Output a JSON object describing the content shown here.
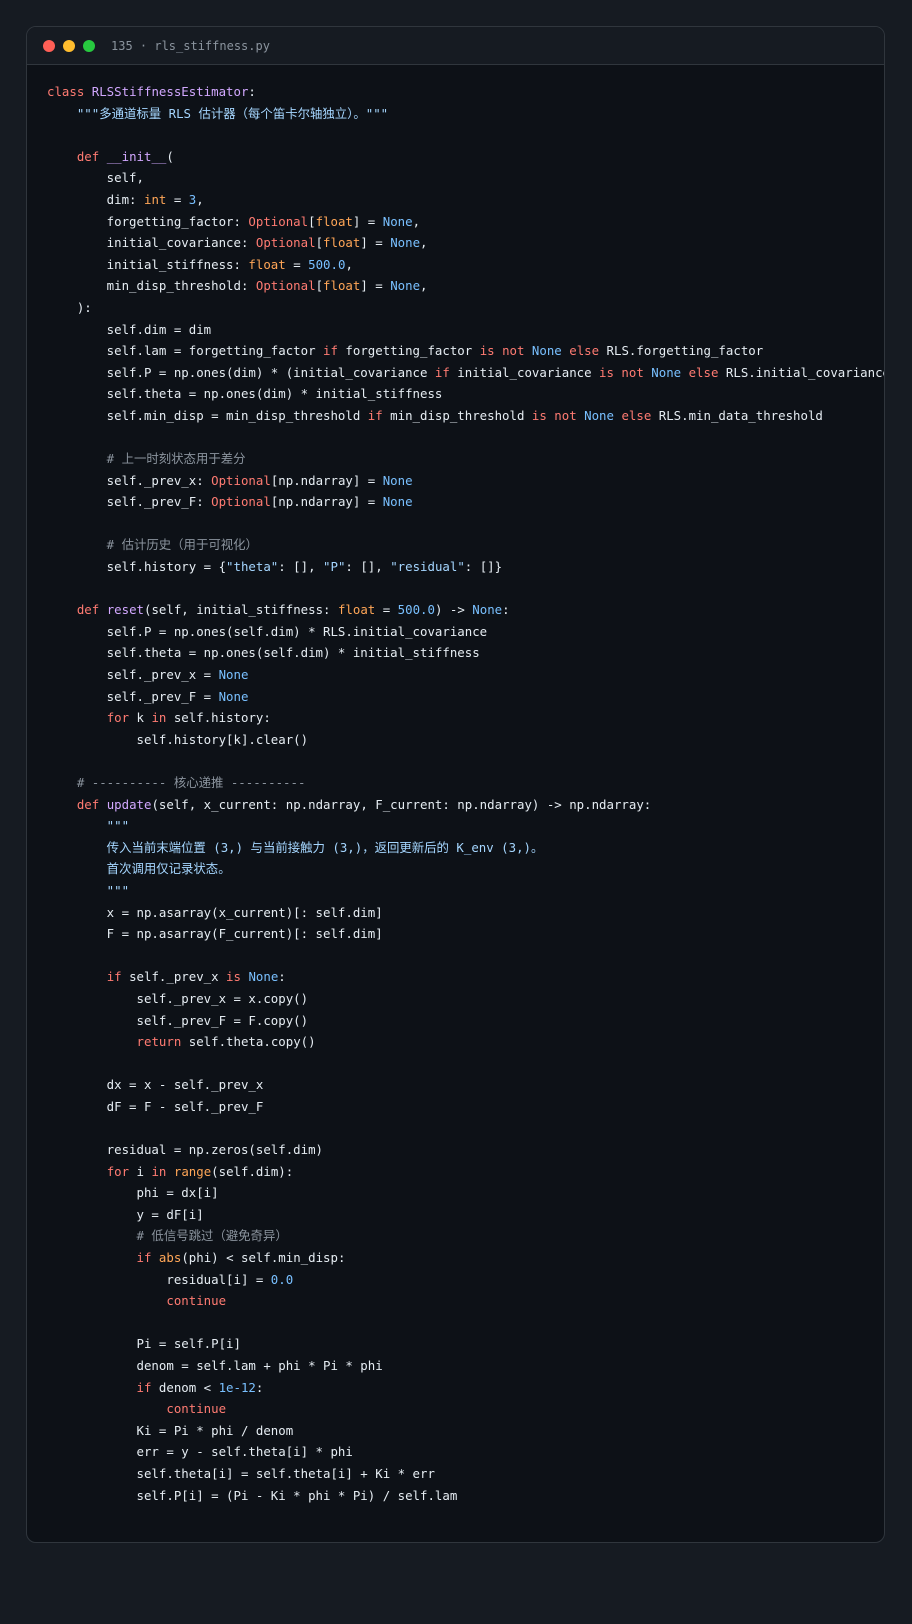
{
  "window": {
    "title": "135 · rls_stiffness.py"
  },
  "code_lines": [
    [
      {
        "t": "class ",
        "c": "kw"
      },
      {
        "t": "RLSStiffnessEstimator",
        "c": "cls"
      },
      {
        "t": ":",
        "c": "pl"
      }
    ],
    [
      {
        "t": "    \"\"\"多通道标量 RLS 估计器（每个笛卡尔轴独立）。\"\"\"",
        "c": "str"
      }
    ],
    [],
    [
      {
        "t": "    ",
        "c": "pl"
      },
      {
        "t": "def ",
        "c": "kw"
      },
      {
        "t": "__init__",
        "c": "fn"
      },
      {
        "t": "(",
        "c": "pl"
      }
    ],
    [
      {
        "t": "        self,",
        "c": "pl"
      }
    ],
    [
      {
        "t": "        dim: ",
        "c": "pl"
      },
      {
        "t": "int",
        "c": "bi"
      },
      {
        "t": " = ",
        "c": "pl"
      },
      {
        "t": "3",
        "c": "num"
      },
      {
        "t": ",",
        "c": "pl"
      }
    ],
    [
      {
        "t": "        forgetting_factor: ",
        "c": "pl"
      },
      {
        "t": "Optional",
        "c": "kw"
      },
      {
        "t": "[",
        "c": "pl"
      },
      {
        "t": "float",
        "c": "bi"
      },
      {
        "t": "] = ",
        "c": "pl"
      },
      {
        "t": "None",
        "c": "const"
      },
      {
        "t": ",",
        "c": "pl"
      }
    ],
    [
      {
        "t": "        initial_covariance: ",
        "c": "pl"
      },
      {
        "t": "Optional",
        "c": "kw"
      },
      {
        "t": "[",
        "c": "pl"
      },
      {
        "t": "float",
        "c": "bi"
      },
      {
        "t": "] = ",
        "c": "pl"
      },
      {
        "t": "None",
        "c": "const"
      },
      {
        "t": ",",
        "c": "pl"
      }
    ],
    [
      {
        "t": "        initial_stiffness: ",
        "c": "pl"
      },
      {
        "t": "float",
        "c": "bi"
      },
      {
        "t": " = ",
        "c": "pl"
      },
      {
        "t": "500.0",
        "c": "num"
      },
      {
        "t": ",",
        "c": "pl"
      }
    ],
    [
      {
        "t": "        min_disp_threshold: ",
        "c": "pl"
      },
      {
        "t": "Optional",
        "c": "kw"
      },
      {
        "t": "[",
        "c": "pl"
      },
      {
        "t": "float",
        "c": "bi"
      },
      {
        "t": "] = ",
        "c": "pl"
      },
      {
        "t": "None",
        "c": "const"
      },
      {
        "t": ",",
        "c": "pl"
      }
    ],
    [
      {
        "t": "    ):",
        "c": "pl"
      }
    ],
    [
      {
        "t": "        self.dim = dim",
        "c": "pl"
      }
    ],
    [
      {
        "t": "        self.lam = forgetting_factor ",
        "c": "pl"
      },
      {
        "t": "if",
        "c": "kw"
      },
      {
        "t": " forgetting_factor ",
        "c": "pl"
      },
      {
        "t": "is not",
        "c": "kw"
      },
      {
        "t": " ",
        "c": "pl"
      },
      {
        "t": "None",
        "c": "const"
      },
      {
        "t": " ",
        "c": "pl"
      },
      {
        "t": "else",
        "c": "kw"
      },
      {
        "t": " RLS.forgetting_factor",
        "c": "pl"
      }
    ],
    [
      {
        "t": "        self.P = np.ones(dim) * (initial_covariance ",
        "c": "pl"
      },
      {
        "t": "if",
        "c": "kw"
      },
      {
        "t": " initial_covariance ",
        "c": "pl"
      },
      {
        "t": "is not",
        "c": "kw"
      },
      {
        "t": " ",
        "c": "pl"
      },
      {
        "t": "None",
        "c": "const"
      },
      {
        "t": " ",
        "c": "pl"
      },
      {
        "t": "else",
        "c": "kw"
      },
      {
        "t": " RLS.initial_covariance",
        "c": "pl"
      }
    ],
    [
      {
        "t": "        self.theta = np.ones(dim) * initial_stiffness",
        "c": "pl"
      }
    ],
    [
      {
        "t": "        self.min_disp = min_disp_threshold ",
        "c": "pl"
      },
      {
        "t": "if",
        "c": "kw"
      },
      {
        "t": " min_disp_threshold ",
        "c": "pl"
      },
      {
        "t": "is not",
        "c": "kw"
      },
      {
        "t": " ",
        "c": "pl"
      },
      {
        "t": "None",
        "c": "const"
      },
      {
        "t": " ",
        "c": "pl"
      },
      {
        "t": "else",
        "c": "kw"
      },
      {
        "t": " RLS.min_data_threshold",
        "c": "pl"
      }
    ],
    [],
    [
      {
        "t": "        # 上一时刻状态用于差分",
        "c": "cm"
      }
    ],
    [
      {
        "t": "        self._prev_x: ",
        "c": "pl"
      },
      {
        "t": "Optional",
        "c": "kw"
      },
      {
        "t": "[np.ndarray] = ",
        "c": "pl"
      },
      {
        "t": "None",
        "c": "const"
      }
    ],
    [
      {
        "t": "        self._prev_F: ",
        "c": "pl"
      },
      {
        "t": "Optional",
        "c": "kw"
      },
      {
        "t": "[np.ndarray] = ",
        "c": "pl"
      },
      {
        "t": "None",
        "c": "const"
      }
    ],
    [],
    [
      {
        "t": "        # 估计历史（用于可视化）",
        "c": "cm"
      }
    ],
    [
      {
        "t": "        self.history = {",
        "c": "pl"
      },
      {
        "t": "\"theta\"",
        "c": "str"
      },
      {
        "t": ": [], ",
        "c": "pl"
      },
      {
        "t": "\"P\"",
        "c": "str"
      },
      {
        "t": ": [], ",
        "c": "pl"
      },
      {
        "t": "\"residual\"",
        "c": "str"
      },
      {
        "t": ": []}",
        "c": "pl"
      }
    ],
    [],
    [
      {
        "t": "    ",
        "c": "pl"
      },
      {
        "t": "def ",
        "c": "kw"
      },
      {
        "t": "reset",
        "c": "fn"
      },
      {
        "t": "(self, initial_stiffness: ",
        "c": "pl"
      },
      {
        "t": "float",
        "c": "bi"
      },
      {
        "t": " = ",
        "c": "pl"
      },
      {
        "t": "500.0",
        "c": "num"
      },
      {
        "t": ") -> ",
        "c": "pl"
      },
      {
        "t": "None",
        "c": "const"
      },
      {
        "t": ":",
        "c": "pl"
      }
    ],
    [
      {
        "t": "        self.P = np.ones(self.dim) * RLS.initial_covariance",
        "c": "pl"
      }
    ],
    [
      {
        "t": "        self.theta = np.ones(self.dim) * initial_stiffness",
        "c": "pl"
      }
    ],
    [
      {
        "t": "        self._prev_x = ",
        "c": "pl"
      },
      {
        "t": "None",
        "c": "const"
      }
    ],
    [
      {
        "t": "        self._prev_F = ",
        "c": "pl"
      },
      {
        "t": "None",
        "c": "const"
      }
    ],
    [
      {
        "t": "        ",
        "c": "pl"
      },
      {
        "t": "for",
        "c": "kw"
      },
      {
        "t": " k ",
        "c": "pl"
      },
      {
        "t": "in",
        "c": "kw"
      },
      {
        "t": " self.history:",
        "c": "pl"
      }
    ],
    [
      {
        "t": "            self.history[k].clear()",
        "c": "pl"
      }
    ],
    [],
    [
      {
        "t": "    # ---------- 核心递推 ----------",
        "c": "cm"
      }
    ],
    [
      {
        "t": "    ",
        "c": "pl"
      },
      {
        "t": "def ",
        "c": "kw"
      },
      {
        "t": "update",
        "c": "fn"
      },
      {
        "t": "(self, x_current: np.ndarray, F_current: np.ndarray) -> np.ndarray:",
        "c": "pl"
      }
    ],
    [
      {
        "t": "        \"\"\"",
        "c": "str"
      }
    ],
    [
      {
        "t": "        传入当前末端位置 (3,) 与当前接触力 (3,)，返回更新后的 K_env (3,)。",
        "c": "str"
      }
    ],
    [
      {
        "t": "        首次调用仅记录状态。",
        "c": "str"
      }
    ],
    [
      {
        "t": "        \"\"\"",
        "c": "str"
      }
    ],
    [
      {
        "t": "        x = np.asarray(x_current)[: self.dim]",
        "c": "pl"
      }
    ],
    [
      {
        "t": "        F = np.asarray(F_current)[: self.dim]",
        "c": "pl"
      }
    ],
    [],
    [
      {
        "t": "        ",
        "c": "pl"
      },
      {
        "t": "if",
        "c": "kw"
      },
      {
        "t": " self._prev_x ",
        "c": "pl"
      },
      {
        "t": "is",
        "c": "kw"
      },
      {
        "t": " ",
        "c": "pl"
      },
      {
        "t": "None",
        "c": "const"
      },
      {
        "t": ":",
        "c": "pl"
      }
    ],
    [
      {
        "t": "            self._prev_x = x.copy()",
        "c": "pl"
      }
    ],
    [
      {
        "t": "            self._prev_F = F.copy()",
        "c": "pl"
      }
    ],
    [
      {
        "t": "            ",
        "c": "pl"
      },
      {
        "t": "return",
        "c": "kw"
      },
      {
        "t": " self.theta.copy()",
        "c": "pl"
      }
    ],
    [],
    [
      {
        "t": "        dx = x - self._prev_x",
        "c": "pl"
      }
    ],
    [
      {
        "t": "        dF = F - self._prev_F",
        "c": "pl"
      }
    ],
    [],
    [
      {
        "t": "        residual = np.zeros(self.dim)",
        "c": "pl"
      }
    ],
    [
      {
        "t": "        ",
        "c": "pl"
      },
      {
        "t": "for",
        "c": "kw"
      },
      {
        "t": " i ",
        "c": "pl"
      },
      {
        "t": "in",
        "c": "kw"
      },
      {
        "t": " ",
        "c": "pl"
      },
      {
        "t": "range",
        "c": "bi"
      },
      {
        "t": "(self.dim):",
        "c": "pl"
      }
    ],
    [
      {
        "t": "            phi = dx[i]",
        "c": "pl"
      }
    ],
    [
      {
        "t": "            y = dF[i]",
        "c": "pl"
      }
    ],
    [
      {
        "t": "            # 低信号跳过（避免奇异）",
        "c": "cm"
      }
    ],
    [
      {
        "t": "            ",
        "c": "pl"
      },
      {
        "t": "if",
        "c": "kw"
      },
      {
        "t": " ",
        "c": "pl"
      },
      {
        "t": "abs",
        "c": "bi"
      },
      {
        "t": "(phi) < self.min_disp:",
        "c": "pl"
      }
    ],
    [
      {
        "t": "                residual[i] = ",
        "c": "pl"
      },
      {
        "t": "0.0",
        "c": "num"
      }
    ],
    [
      {
        "t": "                ",
        "c": "pl"
      },
      {
        "t": "continue",
        "c": "kw"
      }
    ],
    [],
    [
      {
        "t": "            Pi = self.P[i]",
        "c": "pl"
      }
    ],
    [
      {
        "t": "            denom = self.lam + phi * Pi * phi",
        "c": "pl"
      }
    ],
    [
      {
        "t": "            ",
        "c": "pl"
      },
      {
        "t": "if",
        "c": "kw"
      },
      {
        "t": " denom < ",
        "c": "pl"
      },
      {
        "t": "1e-12",
        "c": "num"
      },
      {
        "t": ":",
        "c": "pl"
      }
    ],
    [
      {
        "t": "                ",
        "c": "pl"
      },
      {
        "t": "continue",
        "c": "kw"
      }
    ],
    [
      {
        "t": "            Ki = Pi * phi / denom",
        "c": "pl"
      }
    ],
    [
      {
        "t": "            err = y - self.theta[i] * phi",
        "c": "pl"
      }
    ],
    [
      {
        "t": "            self.theta[i] = self.theta[i] + Ki * err",
        "c": "pl"
      }
    ],
    [
      {
        "t": "            self.P[i] = (Pi - Ki * phi * Pi) / self.lam",
        "c": "pl"
      }
    ]
  ]
}
